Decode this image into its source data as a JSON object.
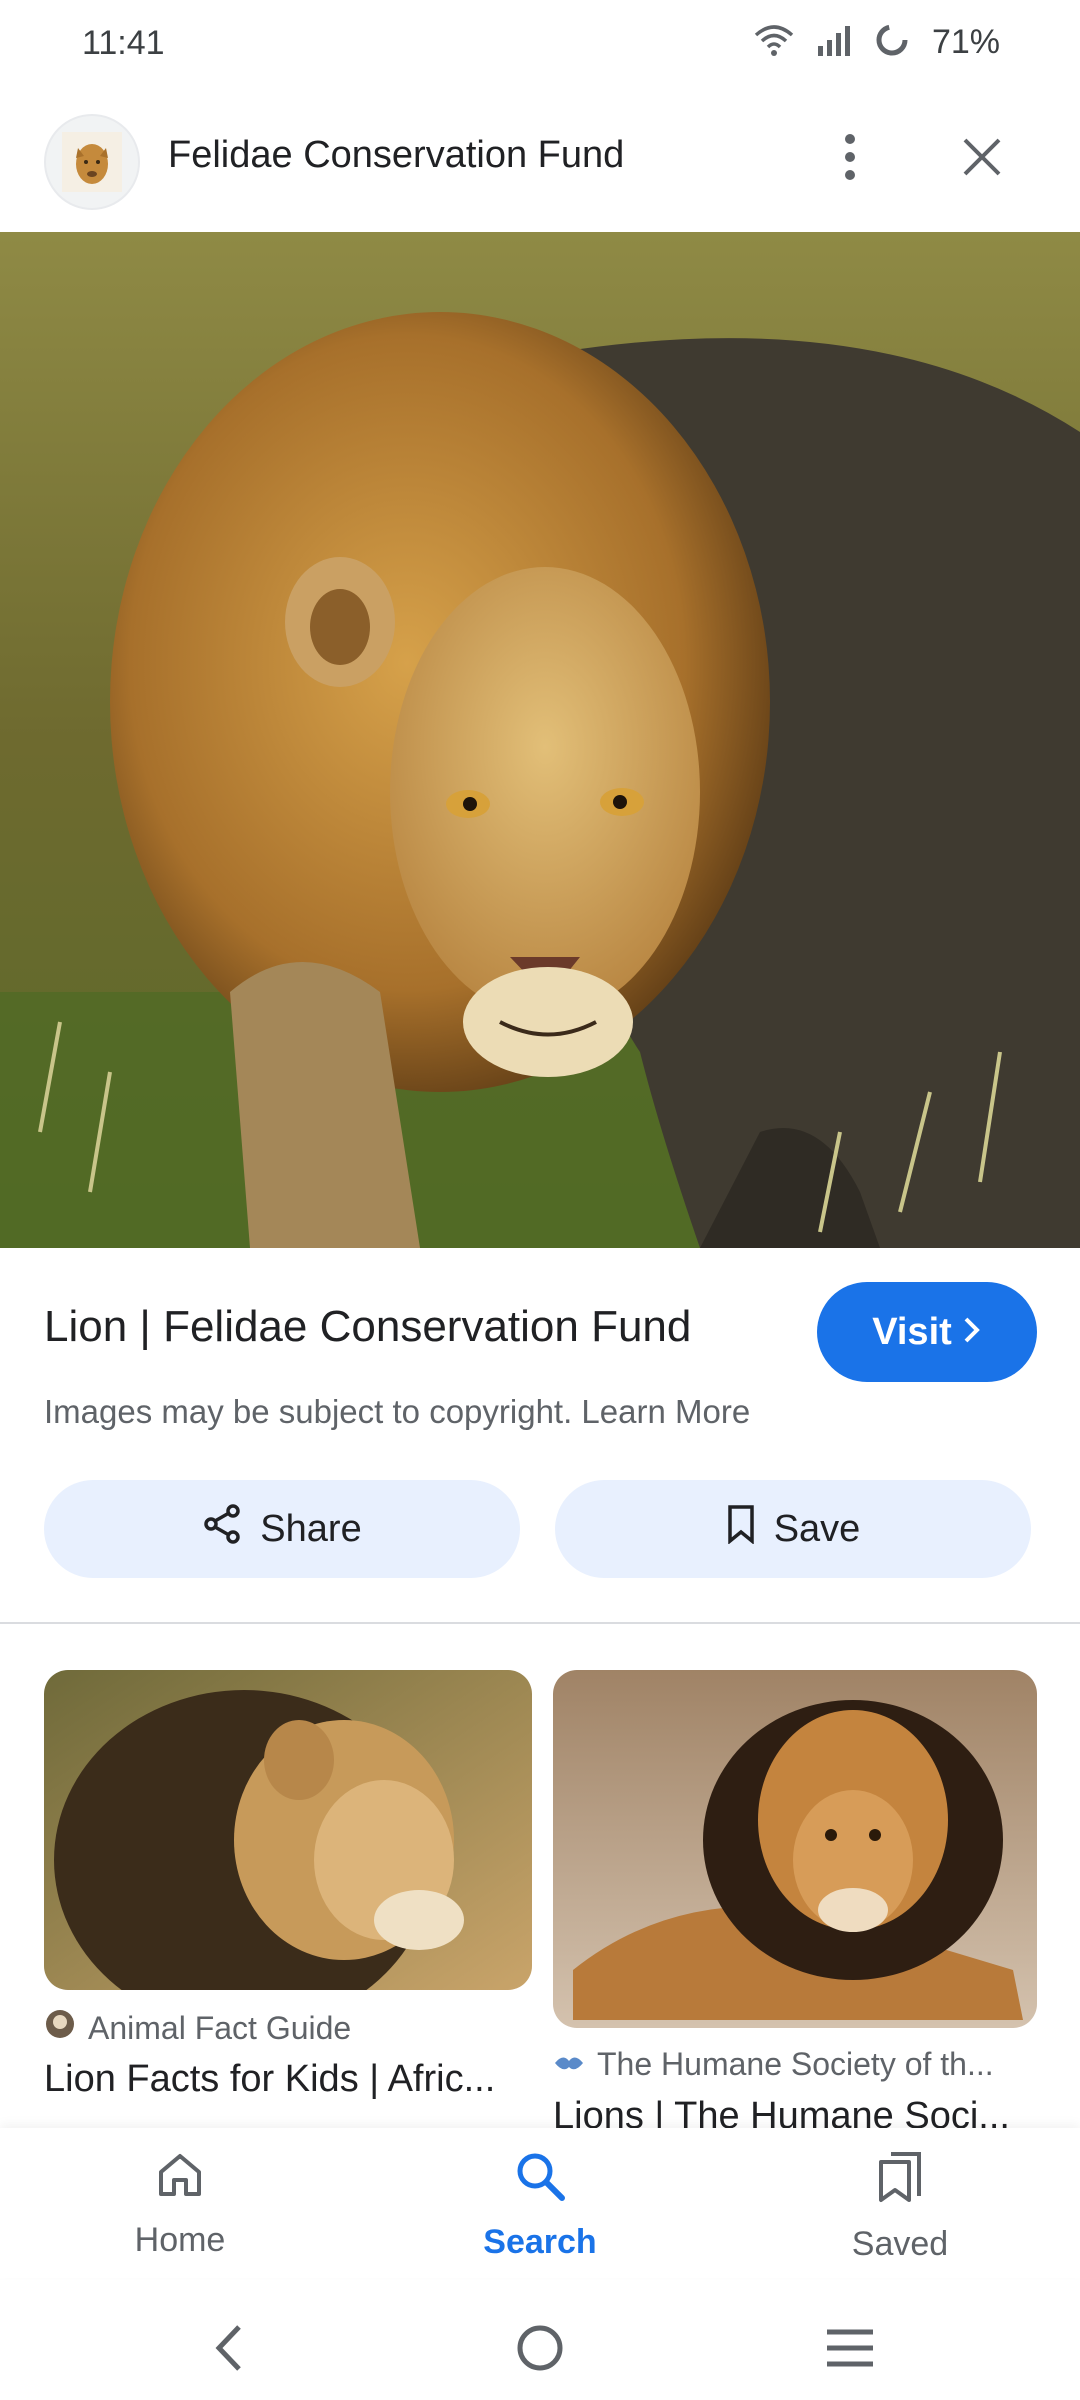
{
  "status_bar": {
    "time": "11:41",
    "battery": "71%"
  },
  "header": {
    "site_name": "Felidae Conservation Fund"
  },
  "result": {
    "title": "Lion | Felidae Conservation Fund",
    "visit_label": "Visit",
    "copyright": "Images may be subject to copyright. Learn More"
  },
  "actions": {
    "share": "Share",
    "save": "Save"
  },
  "related": [
    {
      "source": "Animal Fact Guide",
      "title": "Lion Facts for Kids | Afric..."
    },
    {
      "source": "The Humane Society of th...",
      "title": "Lions | The Humane Soci..."
    }
  ],
  "bottom_nav": {
    "home": "Home",
    "search": "Search",
    "saved": "Saved"
  },
  "colors": {
    "accent": "#1a73e8",
    "pill_bg": "#e8f0fe"
  },
  "icons": [
    "wifi-icon",
    "signal-icon",
    "battery-icon",
    "more-vert-icon",
    "close-icon",
    "share-icon",
    "bookmark-icon",
    "chevron-right-icon",
    "home-icon",
    "search-icon",
    "saved-icon",
    "back-icon",
    "home-circle-icon",
    "recents-icon"
  ]
}
